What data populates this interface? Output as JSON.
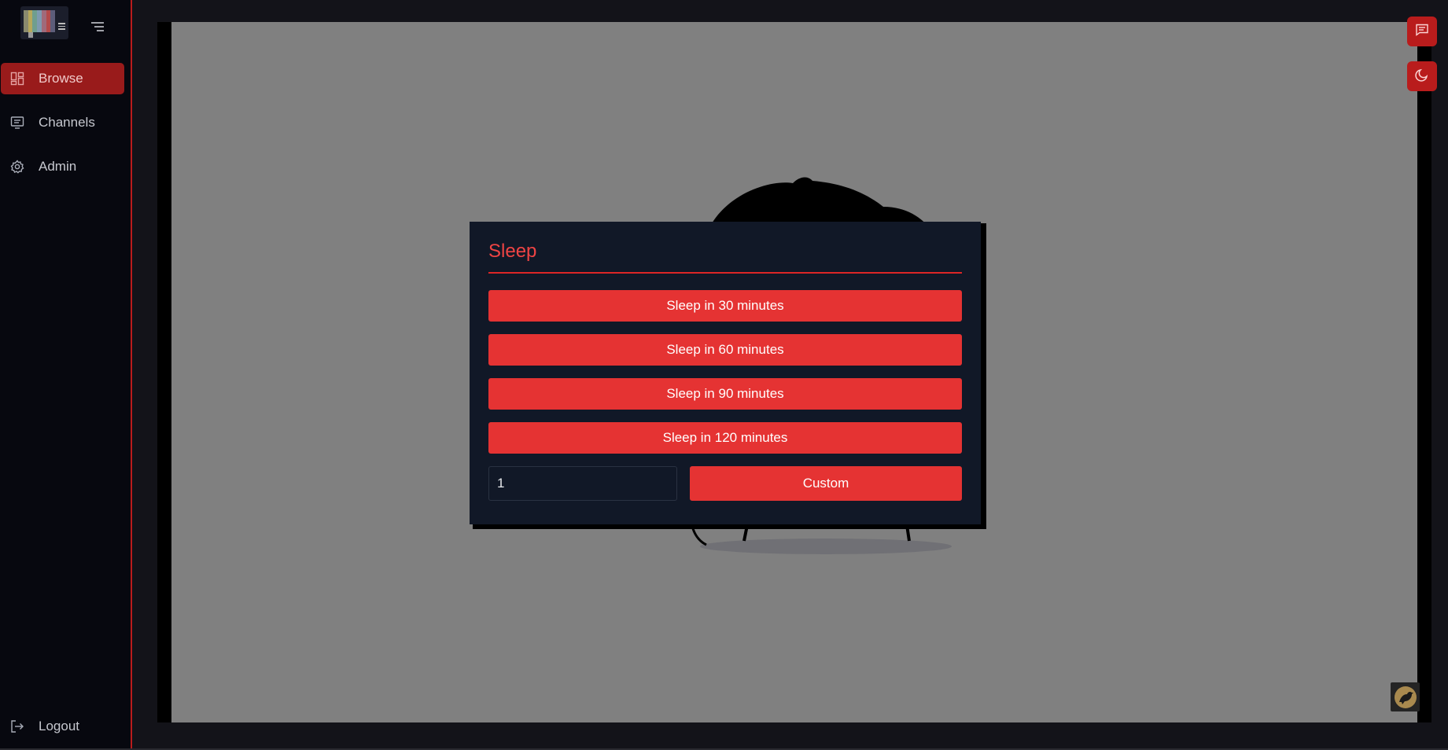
{
  "sidebar": {
    "logo_colors": [
      "#8a8a6e",
      "#b6a85c",
      "#6f9e8e",
      "#7e9ab0",
      "#a06a7a",
      "#b34a4a",
      "#5d5d7a"
    ],
    "items": [
      {
        "label": "Browse",
        "icon": "grid-icon",
        "active": true
      },
      {
        "label": "Channels",
        "icon": "monitor-icon",
        "active": false
      },
      {
        "label": "Admin",
        "icon": "gear-icon",
        "active": false
      }
    ],
    "logout_label": "Logout"
  },
  "floating_buttons": [
    {
      "icon": "chat-icon"
    },
    {
      "icon": "moon-icon"
    }
  ],
  "modal": {
    "title": "Sleep",
    "options": [
      {
        "label": "Sleep in 30 minutes"
      },
      {
        "label": "Sleep in 60 minutes"
      },
      {
        "label": "Sleep in 90 minutes"
      },
      {
        "label": "Sleep in 120 minutes"
      }
    ],
    "custom_value": "1",
    "custom_label": "Custom"
  },
  "colors": {
    "accent": "#e53333",
    "sidebar_active": "#991b1b",
    "modal_bg": "#111827",
    "video_bg": "#808080"
  }
}
